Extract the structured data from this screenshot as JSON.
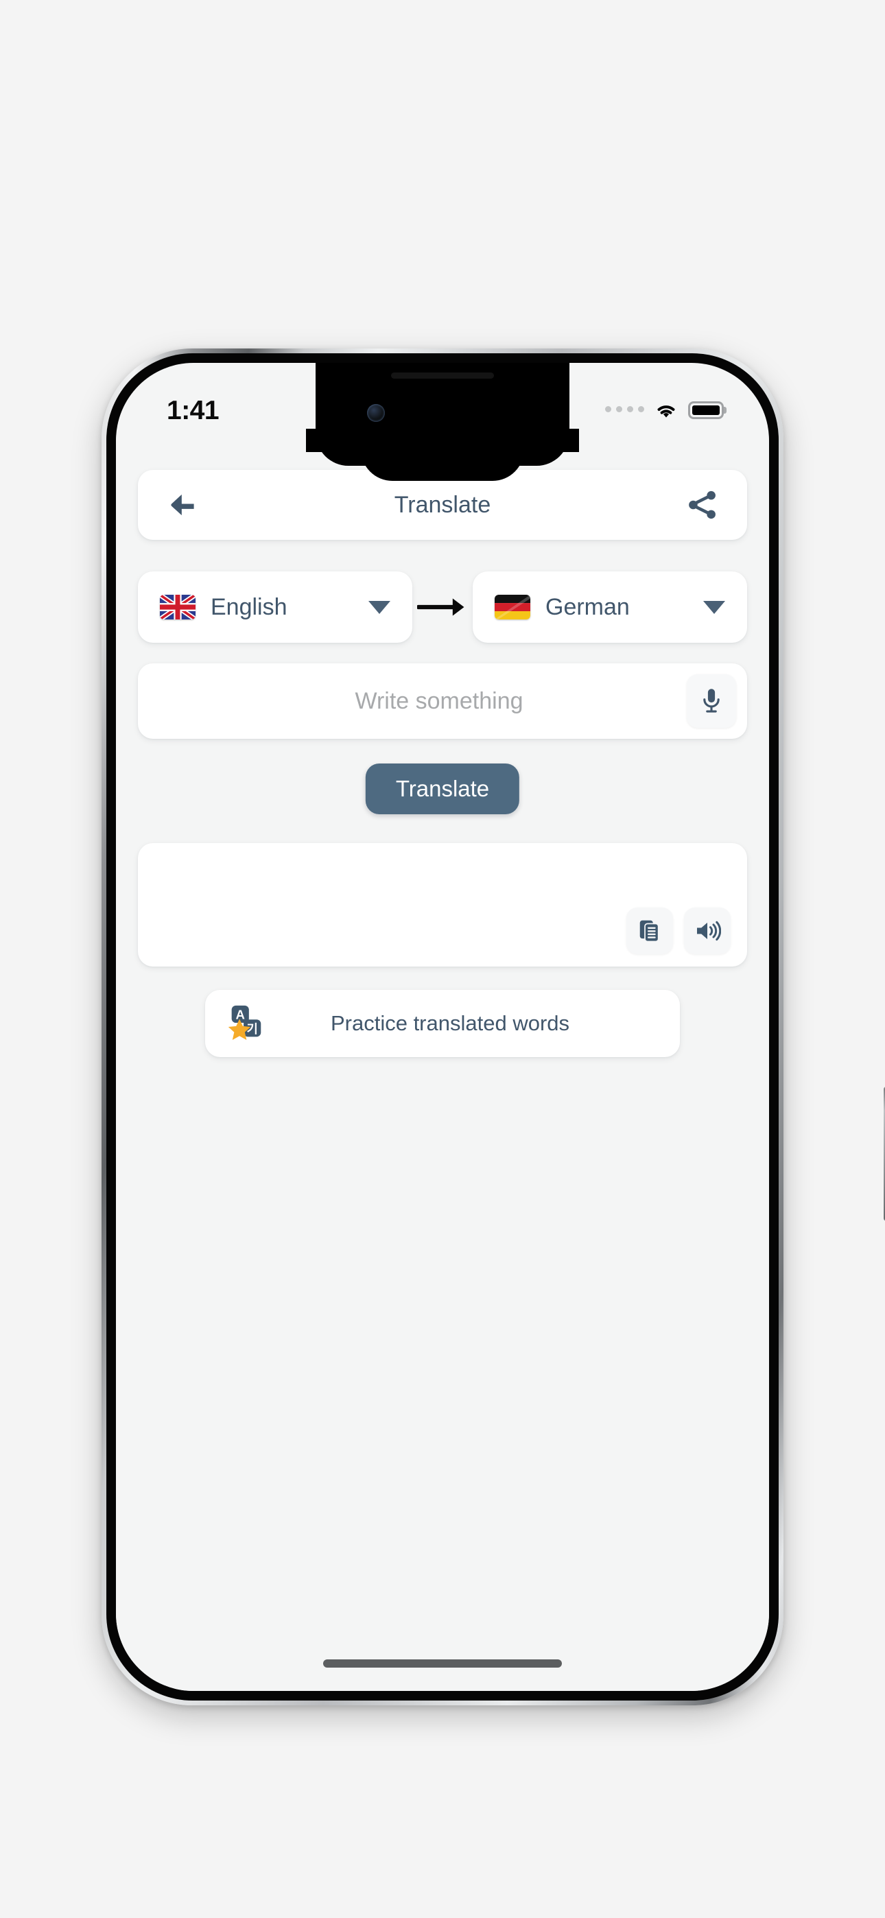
{
  "status_bar": {
    "time": "1:41",
    "signal_icon": "signal-dots-icon",
    "wifi_icon": "wifi-icon",
    "battery_icon": "battery-full-icon"
  },
  "app_bar": {
    "back_icon": "back-arrow-icon",
    "title": "Translate",
    "share_icon": "share-icon"
  },
  "language_row": {
    "source": {
      "label": "English",
      "flag": "flag-uk",
      "caret_icon": "chevron-down-icon"
    },
    "direction_icon": "right-arrow-icon",
    "target": {
      "label": "German",
      "flag": "flag-germany",
      "caret_icon": "chevron-down-icon"
    }
  },
  "input": {
    "value": "",
    "placeholder": "Write something",
    "mic_icon": "microphone-icon"
  },
  "translate_button": {
    "label": "Translate"
  },
  "result": {
    "text": "",
    "copy_icon": "copy-icon",
    "speaker_icon": "speaker-volume-icon"
  },
  "practice": {
    "label": "Practice translated words",
    "icon": "translate-star-icon"
  },
  "colors": {
    "accent": "#4e6a81",
    "text": "#41566b",
    "placeholder": "#a7a9ab",
    "screen_bg": "#f4f5f5",
    "card_bg": "#ffffff",
    "star": "#f5ab29"
  }
}
